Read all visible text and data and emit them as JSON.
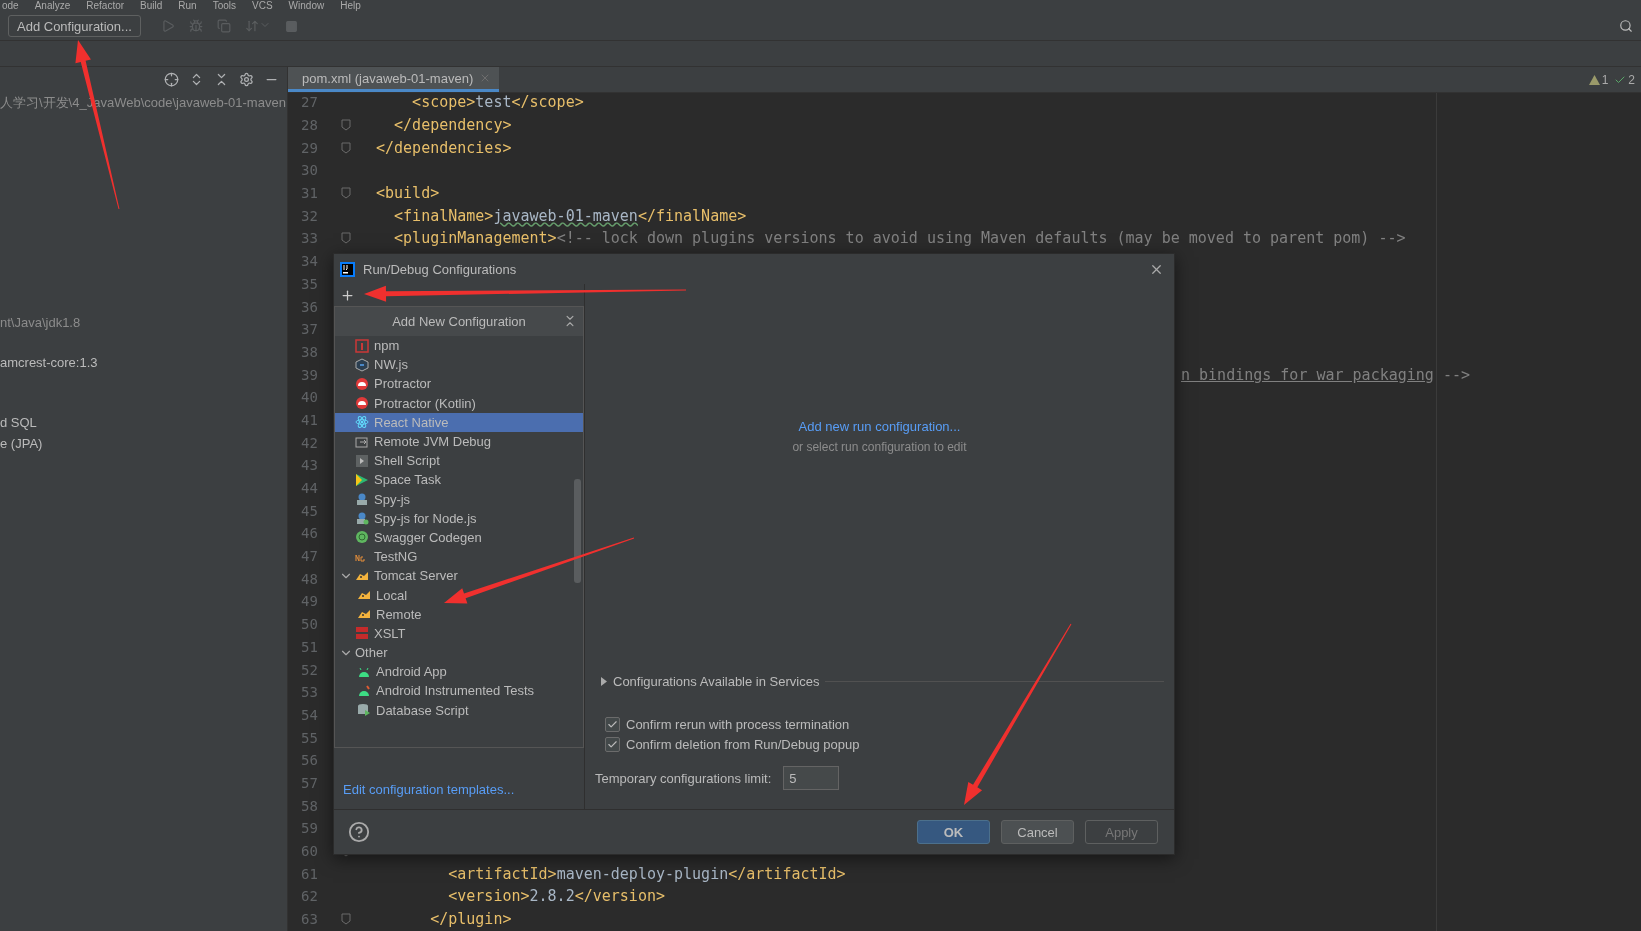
{
  "menu": [
    "ode",
    "Analyze",
    "Refactor",
    "Build",
    "Run",
    "Tools",
    "VCS",
    "Window",
    "Help"
  ],
  "toolbar": {
    "config_button": "Add Configuration..."
  },
  "project_panel": {
    "rows": [
      "人学习\\开发\\4_JavaWeb\\code\\javaweb-01-maven",
      "nt\\Java\\jdk1.8",
      "amcrest-core:1.3",
      "d SQL",
      "e (JPA)"
    ]
  },
  "editor": {
    "tab": {
      "label": "pom.xml (javaweb-01-maven)",
      "selected": true
    },
    "inspections": {
      "warnings": "1",
      "typos": "2"
    },
    "lines": [
      {
        "num": "27",
        "fold": false,
        "tokens": [
          {
            "kind": "tag",
            "text": "    <scope>"
          },
          {
            "kind": "text",
            "text": "test"
          },
          {
            "kind": "tag",
            "text": "</scope>"
          }
        ]
      },
      {
        "num": "28",
        "fold": true,
        "tokens": [
          {
            "kind": "tag",
            "text": "  </dependency>"
          }
        ]
      },
      {
        "num": "29",
        "fold": true,
        "tokens": [
          {
            "kind": "tag",
            "text": "</dependencies>"
          }
        ]
      },
      {
        "num": "30",
        "fold": false
      },
      {
        "num": "31",
        "fold": true,
        "tokens": [
          {
            "kind": "tag",
            "text": "<build>"
          }
        ]
      },
      {
        "num": "32",
        "fold": false,
        "tokens": [
          {
            "kind": "tag",
            "text": "  <finalName>"
          },
          {
            "kind": "typo",
            "text": "javaweb-01-maven"
          },
          {
            "kind": "tag",
            "text": "</finalName>"
          }
        ]
      },
      {
        "num": "33",
        "fold": true,
        "tokens": [
          {
            "kind": "tag",
            "text": "  <pluginManagement>"
          },
          {
            "kind": "comment",
            "text": "<!-- lock down plugins versions to avoid using Maven defaults (may be moved to parent pom) -->"
          }
        ]
      },
      {
        "num": "34",
        "fold": false
      },
      {
        "num": "35",
        "fold": false
      },
      {
        "num": "36",
        "fold": false
      },
      {
        "num": "37",
        "fold": false
      },
      {
        "num": "38",
        "fold": false
      },
      {
        "num": "39",
        "fold": false,
        "tail": true,
        "tokens": [
          {
            "kind": "link",
            "text": "n bindings for war packaging"
          },
          {
            "kind": "comment",
            "text": " -->"
          }
        ]
      },
      {
        "num": "40",
        "fold": false
      },
      {
        "num": "41",
        "fold": false
      },
      {
        "num": "42",
        "fold": false
      },
      {
        "num": "43",
        "fold": false
      },
      {
        "num": "44",
        "fold": false
      },
      {
        "num": "45",
        "fold": false
      },
      {
        "num": "46",
        "fold": false
      },
      {
        "num": "47",
        "fold": false
      },
      {
        "num": "48",
        "fold": false
      },
      {
        "num": "49",
        "fold": false
      },
      {
        "num": "50",
        "fold": false
      },
      {
        "num": "51",
        "fold": false
      },
      {
        "num": "52",
        "fold": false
      },
      {
        "num": "53",
        "fold": false
      },
      {
        "num": "54",
        "fold": false
      },
      {
        "num": "55",
        "fold": false
      },
      {
        "num": "56",
        "fold": false
      },
      {
        "num": "57",
        "fold": false
      },
      {
        "num": "58",
        "fold": false
      },
      {
        "num": "59",
        "fold": false
      },
      {
        "num": "60",
        "fold": true
      },
      {
        "num": "61",
        "fold": false,
        "tokens": [
          {
            "kind": "tag",
            "text": "        <artifactId>"
          },
          {
            "kind": "text",
            "text": "maven-deploy-plugin"
          },
          {
            "kind": "tag",
            "text": "</artifactId>"
          }
        ]
      },
      {
        "num": "62",
        "fold": false,
        "tokens": [
          {
            "kind": "tag",
            "text": "        <version>"
          },
          {
            "kind": "text",
            "text": "2.8.2"
          },
          {
            "kind": "tag",
            "text": "</version>"
          }
        ]
      },
      {
        "num": "63",
        "fold": true,
        "tokens": [
          {
            "kind": "tag",
            "text": "      </plugin>"
          }
        ]
      }
    ]
  },
  "dialog": {
    "title": "Run/Debug Configurations",
    "popup_title": "Add New Configuration",
    "items": [
      {
        "label": "npm",
        "selected": false
      },
      {
        "label": "NW.js",
        "selected": false
      },
      {
        "label": "Protractor",
        "selected": false
      },
      {
        "label": "Protractor (Kotlin)",
        "selected": false
      },
      {
        "label": "React Native",
        "selected": true
      },
      {
        "label": "Remote JVM Debug",
        "selected": false
      },
      {
        "label": "Shell Script",
        "selected": false
      },
      {
        "label": "Space Task",
        "selected": false
      },
      {
        "label": "Spy-js",
        "selected": false
      },
      {
        "label": "Spy-js for Node.js",
        "selected": false
      },
      {
        "label": "Swagger Codegen",
        "selected": false
      },
      {
        "label": "TestNG",
        "selected": false
      },
      {
        "label": "Tomcat Server",
        "selected": false,
        "expanded": true,
        "children": [
          {
            "label": "Local",
            "selected": false
          },
          {
            "label": "Remote",
            "selected": false
          }
        ]
      },
      {
        "label": "XSLT",
        "selected": false
      },
      {
        "label": "Other",
        "selected": false,
        "expanded": true,
        "children": [
          {
            "label": "Android App",
            "selected": false
          },
          {
            "label": "Android Instrumented Tests",
            "selected": false
          },
          {
            "label": "Database Script",
            "selected": false
          }
        ]
      }
    ],
    "templates_link": "Edit configuration templates...",
    "add_link": "Add new run configuration...",
    "hint": "or select run configuration to edit",
    "services": {
      "label": "Configurations Available in Services",
      "expanded": false
    },
    "options": [
      {
        "label": "Confirm rerun with process termination",
        "checked": true
      },
      {
        "label": "Confirm deletion from Run/Debug popup",
        "checked": true
      }
    ],
    "limit": {
      "label": "Temporary configurations limit:",
      "value": "5"
    },
    "buttons": [
      {
        "label": "OK",
        "kind": "primary",
        "disabled": false
      },
      {
        "label": "Cancel",
        "kind": "normal",
        "disabled": false
      },
      {
        "label": "Apply",
        "kind": "normal",
        "disabled": true
      }
    ]
  }
}
